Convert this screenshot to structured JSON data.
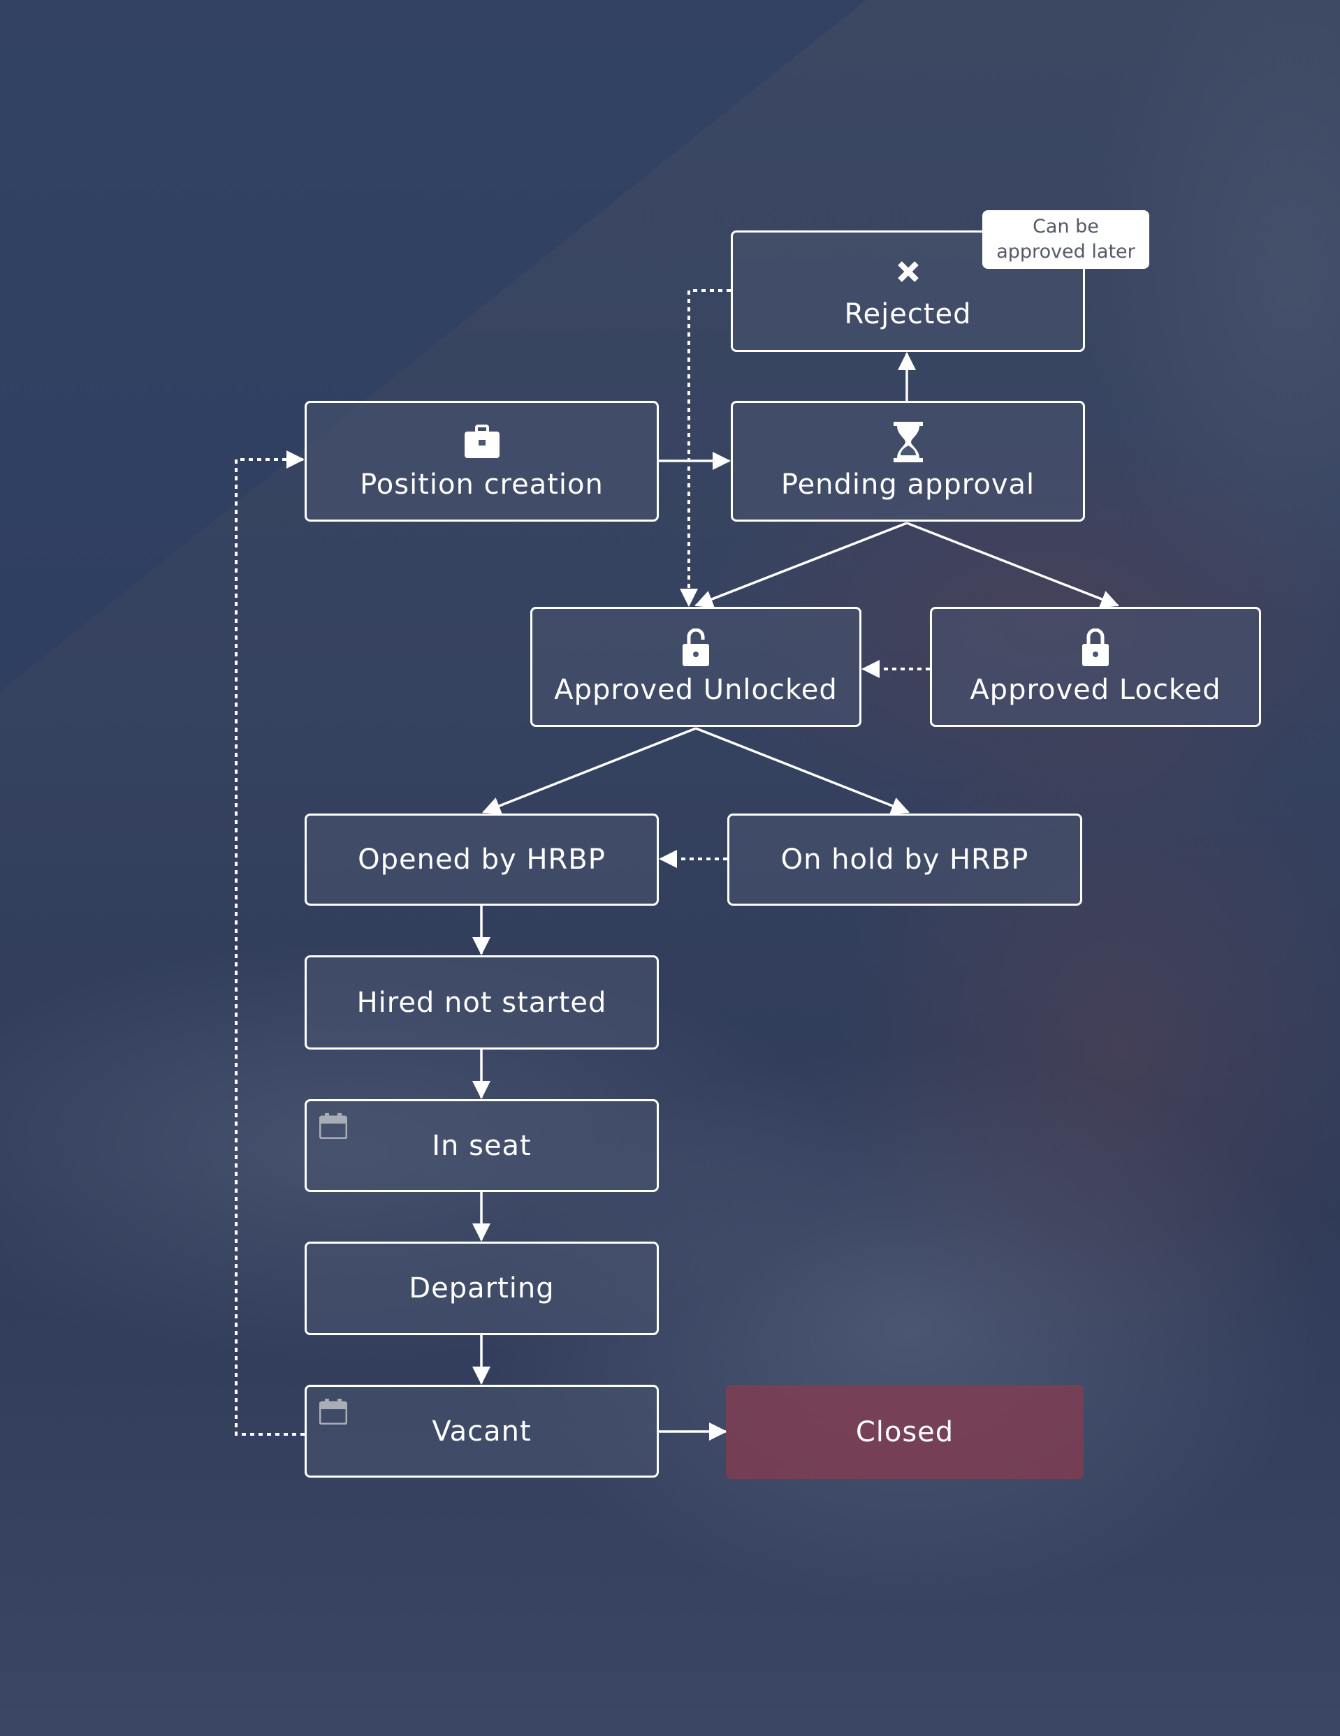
{
  "diagram": {
    "type": "state-flowchart",
    "nodes": [
      {
        "id": "rejected",
        "label": "Rejected",
        "icon": "close-x-icon"
      },
      {
        "id": "position_creation",
        "label": "Position creation",
        "icon": "briefcase-icon"
      },
      {
        "id": "pending_approval",
        "label": "Pending approval",
        "icon": "hourglass-icon"
      },
      {
        "id": "approved_unlocked",
        "label": "Approved Unlocked",
        "icon": "unlock-icon"
      },
      {
        "id": "approved_locked",
        "label": "Approved Locked",
        "icon": "lock-icon"
      },
      {
        "id": "opened_by_hrbp",
        "label": "Opened by HRBP"
      },
      {
        "id": "on_hold_by_hrbp",
        "label": "On hold by HRBP"
      },
      {
        "id": "hired_not_started",
        "label": "Hired not started"
      },
      {
        "id": "in_seat",
        "label": "In seat",
        "icon": "calendar-icon"
      },
      {
        "id": "departing",
        "label": "Departing"
      },
      {
        "id": "vacant",
        "label": "Vacant",
        "icon": "calendar-icon"
      },
      {
        "id": "closed",
        "label": "Closed"
      }
    ],
    "annotation": {
      "target": "rejected",
      "text_line1": "Can be",
      "text_line2": "approved later"
    },
    "edges": [
      {
        "from": "position_creation",
        "to": "pending_approval",
        "style": "solid"
      },
      {
        "from": "pending_approval",
        "to": "rejected",
        "style": "solid"
      },
      {
        "from": "pending_approval",
        "to": "approved_unlocked",
        "style": "solid"
      },
      {
        "from": "pending_approval",
        "to": "approved_locked",
        "style": "solid"
      },
      {
        "from": "rejected",
        "to": "approved_unlocked",
        "style": "dotted"
      },
      {
        "from": "approved_locked",
        "to": "approved_unlocked",
        "style": "dotted"
      },
      {
        "from": "approved_unlocked",
        "to": "opened_by_hrbp",
        "style": "solid"
      },
      {
        "from": "approved_unlocked",
        "to": "on_hold_by_hrbp",
        "style": "solid"
      },
      {
        "from": "on_hold_by_hrbp",
        "to": "opened_by_hrbp",
        "style": "dotted"
      },
      {
        "from": "opened_by_hrbp",
        "to": "hired_not_started",
        "style": "solid"
      },
      {
        "from": "hired_not_started",
        "to": "in_seat",
        "style": "solid"
      },
      {
        "from": "in_seat",
        "to": "departing",
        "style": "solid"
      },
      {
        "from": "departing",
        "to": "vacant",
        "style": "solid"
      },
      {
        "from": "vacant",
        "to": "closed",
        "style": "solid"
      },
      {
        "from": "vacant",
        "to": "position_creation",
        "style": "dotted"
      }
    ],
    "colors": {
      "node_border": "#ffffff",
      "closed_fill": "#7a4052",
      "background": "#36425e",
      "annotation_text": "#555a66"
    }
  }
}
